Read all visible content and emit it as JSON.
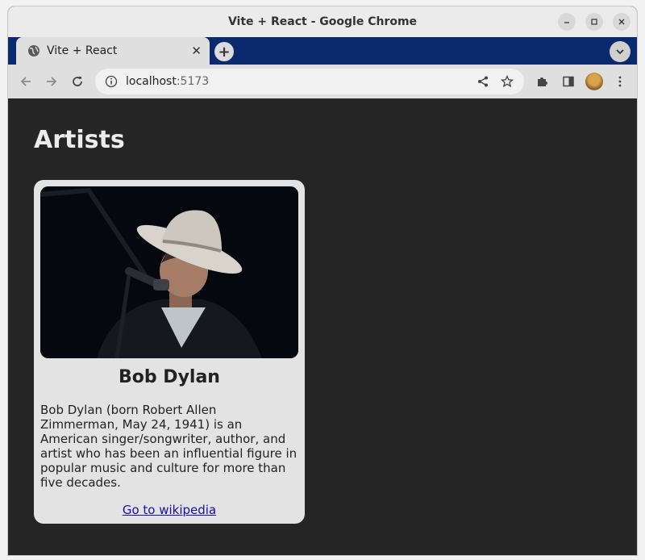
{
  "window": {
    "title": "Vite + React - Google Chrome"
  },
  "tab": {
    "title": "Vite + React",
    "close_glyph": "✕",
    "new_tab_glyph": "+"
  },
  "toolbar": {
    "url_host": "localhost",
    "url_port": ":5173",
    "back_icon": "arrow-left-icon",
    "forward_icon": "arrow-right-icon",
    "reload_icon": "reload-icon",
    "share_icon": "share-icon",
    "bookmark_icon": "star-icon",
    "extensions_icon": "puzzle-icon",
    "sidepanel_icon": "side-panel-icon",
    "menu_icon": "kebab-menu-icon"
  },
  "page": {
    "heading": "Artists",
    "artist": {
      "name": "Bob Dylan",
      "description": "Bob Dylan (born Robert Allen Zimmerman, May 24, 1941) is an American singer/songwriter, author, and artist who has been an influential figure in popular music and culture for more than five decades.",
      "link_label": "Go to wikipedia"
    }
  },
  "colors": {
    "tabstrip": "#0b2a6e",
    "page_bg": "#252525",
    "card_bg": "#e3e3e3",
    "link": "#1a0dab"
  }
}
